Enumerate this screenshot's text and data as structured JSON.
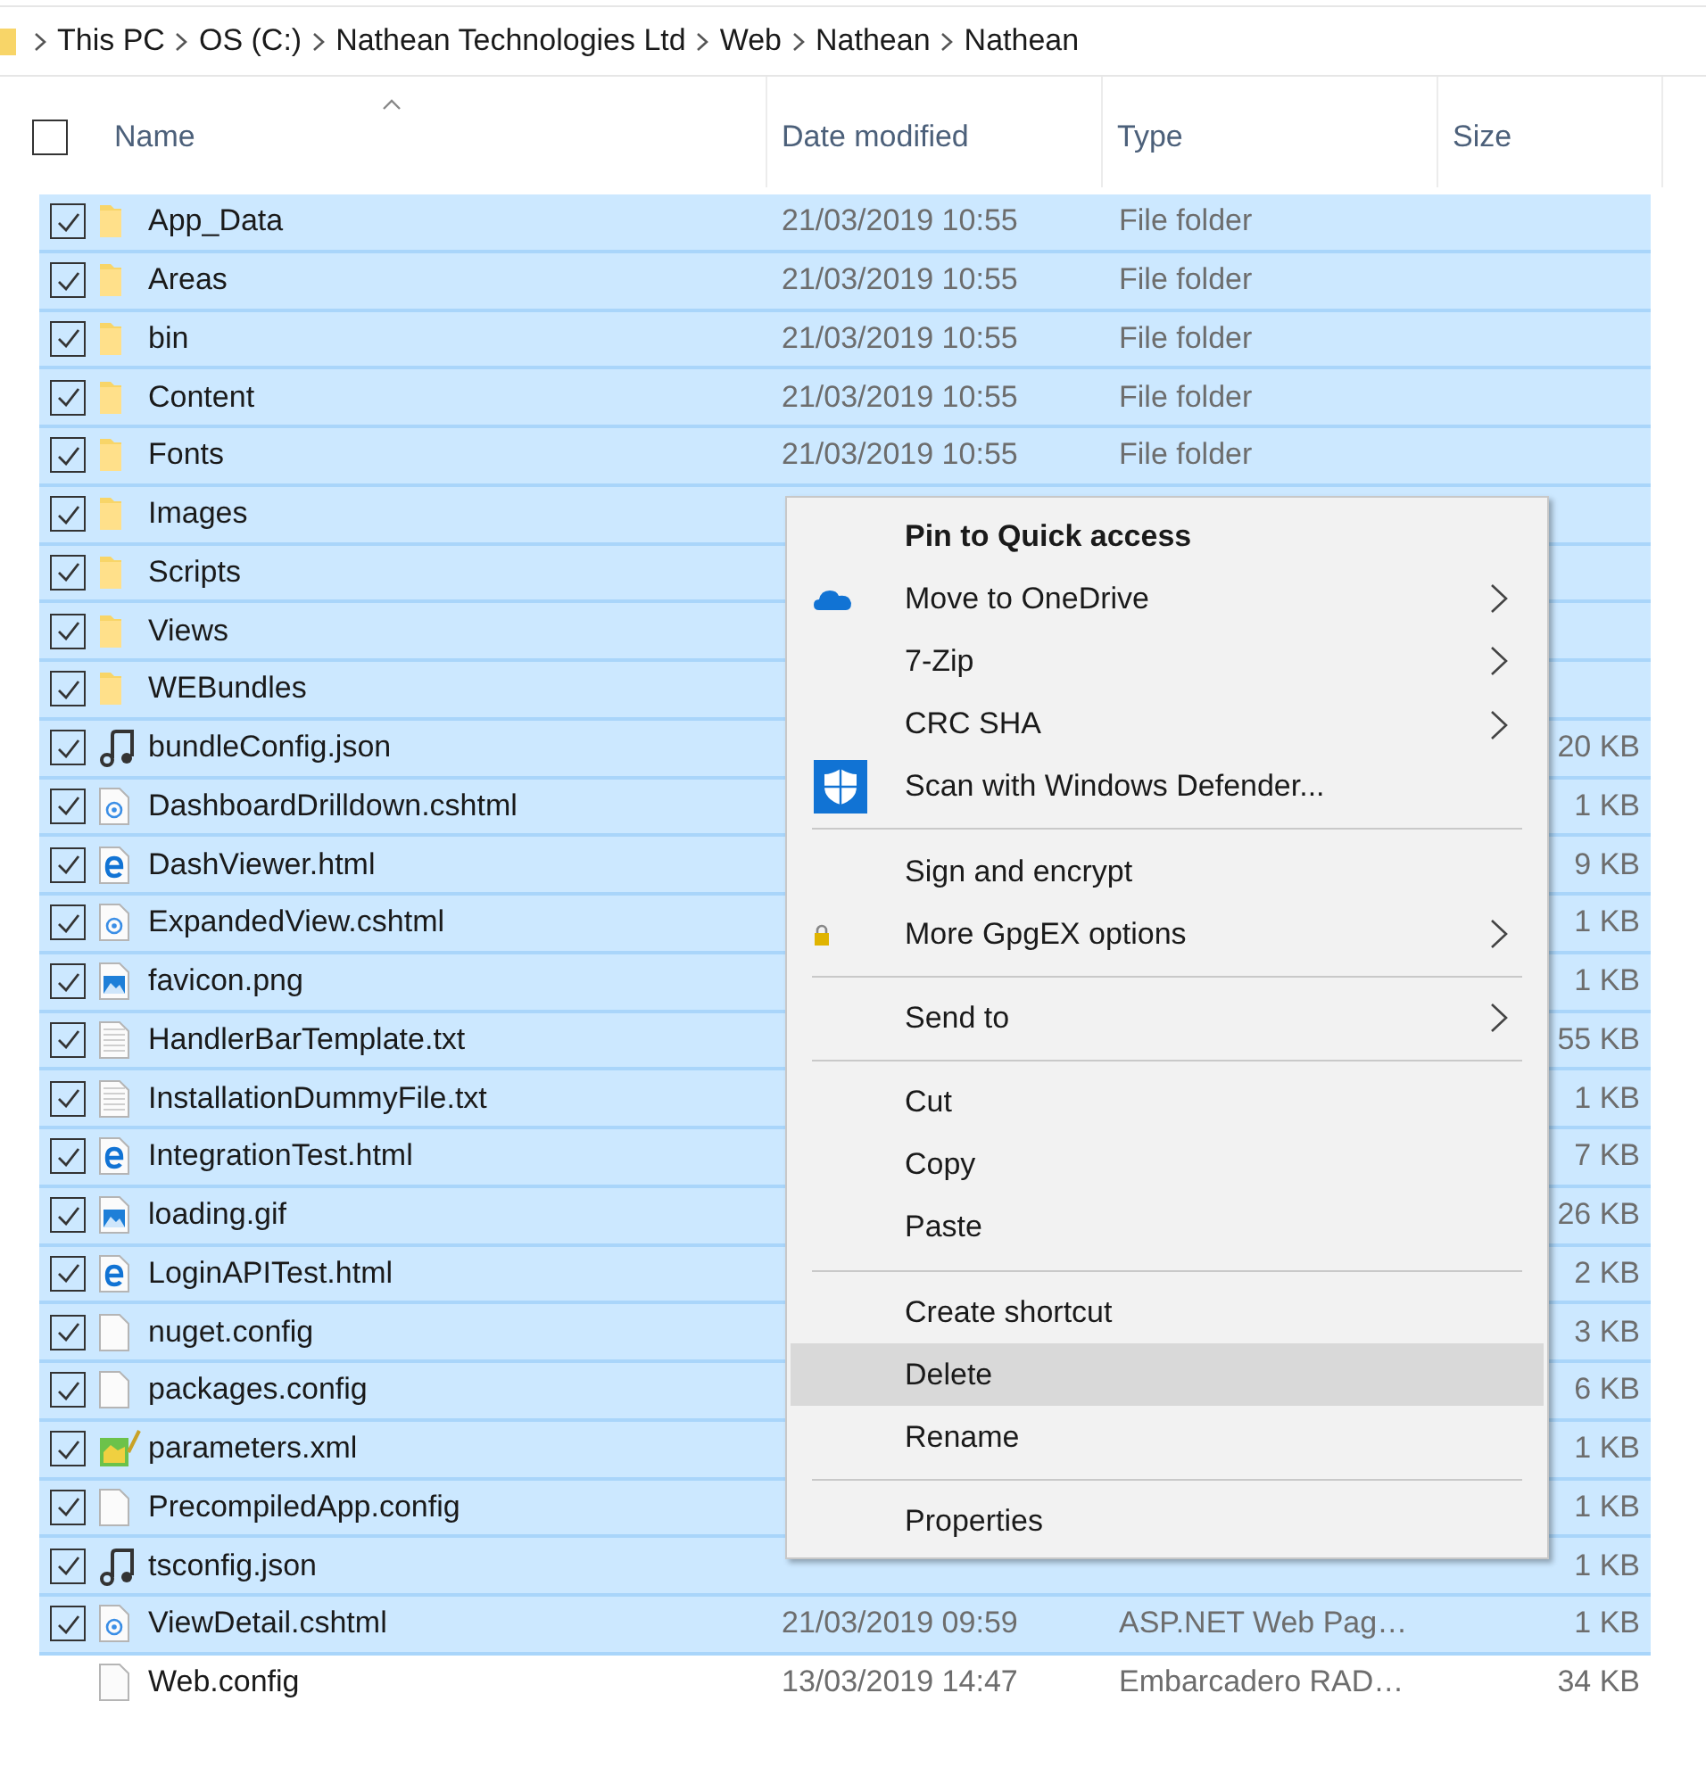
{
  "breadcrumb": [
    "This PC",
    "OS (C:)",
    "Nathean Technologies Ltd",
    "Web",
    "Nathean",
    "Nathean"
  ],
  "header": {
    "select_all": {
      "checked": false
    },
    "columns": [
      "Name",
      "Date modified",
      "Type",
      "Size"
    ]
  },
  "rows": [
    {
      "kind": "folder",
      "name": "App_Data",
      "date": "21/03/2019 10:55",
      "type": "File folder",
      "selected": true
    },
    {
      "kind": "folder",
      "name": "Areas",
      "date": "21/03/2019 10:55",
      "type": "File folder",
      "selected": true
    },
    {
      "kind": "folder",
      "name": "bin",
      "date": "21/03/2019 10:55",
      "type": "File folder",
      "selected": true
    },
    {
      "kind": "folder",
      "name": "Content",
      "date": "21/03/2019 10:55",
      "type": "File folder",
      "selected": true
    },
    {
      "kind": "folder",
      "name": "Fonts",
      "date": "21/03/2019 10:55",
      "type": "File folder",
      "selected": true
    },
    {
      "kind": "folder",
      "name": "Images",
      "selected": true
    },
    {
      "kind": "folder",
      "name": "Scripts",
      "selected": true
    },
    {
      "kind": "folder",
      "name": "Views",
      "selected": true
    },
    {
      "kind": "folder",
      "name": "WEBundles",
      "selected": true
    },
    {
      "kind": "json",
      "name": "bundleConfig.json",
      "size": "20 KB",
      "selected": true
    },
    {
      "kind": "cshtml",
      "name": "DashboardDrilldown.cshtml",
      "size": "1 KB",
      "selected": true
    },
    {
      "kind": "html",
      "name": "DashViewer.html",
      "size": "9 KB",
      "selected": true
    },
    {
      "kind": "cshtml",
      "name": "ExpandedView.cshtml",
      "size": "1 KB",
      "selected": true
    },
    {
      "kind": "image",
      "name": "favicon.png",
      "size": "1 KB",
      "selected": true
    },
    {
      "kind": "text",
      "name": "HandlerBarTemplate.txt",
      "size": "55 KB",
      "selected": true
    },
    {
      "kind": "text",
      "name": "InstallationDummyFile.txt",
      "size": "1 KB",
      "selected": true
    },
    {
      "kind": "html",
      "name": "IntegrationTest.html",
      "size": "7 KB",
      "selected": true
    },
    {
      "kind": "image",
      "name": "loading.gif",
      "size": "26 KB",
      "selected": true
    },
    {
      "kind": "html",
      "name": "LoginAPITest.html",
      "size": "2 KB",
      "selected": true
    },
    {
      "kind": "blank",
      "name": "nuget.config",
      "size": "3 KB",
      "selected": true
    },
    {
      "kind": "blank",
      "name": "packages.config",
      "size": "6 KB",
      "selected": true
    },
    {
      "kind": "xml",
      "name": "parameters.xml",
      "size": "1 KB",
      "selected": true
    },
    {
      "kind": "blank",
      "name": "PrecompiledApp.config",
      "size": "1 KB",
      "selected": true
    },
    {
      "kind": "json",
      "name": "tsconfig.json",
      "size": "1 KB",
      "selected": true
    },
    {
      "kind": "cshtml",
      "name": "ViewDetail.cshtml",
      "date": "21/03/2019 09:59",
      "type": "ASP.NET Web Pag…",
      "size": "1 KB",
      "selected": true
    },
    {
      "kind": "blank",
      "name": "Web.config",
      "date": "13/03/2019 14:47",
      "type": "Embarcadero RAD…",
      "size": "34 KB",
      "selected": false
    }
  ],
  "context_menu": [
    {
      "kind": "item",
      "label": "Pin to Quick access",
      "bold": true,
      "submenu": false,
      "highlighted": false
    },
    {
      "kind": "onedrive",
      "label": "Move to OneDrive",
      "bold": false,
      "submenu": true,
      "highlighted": false
    },
    {
      "kind": "item",
      "label": "7-Zip",
      "bold": false,
      "submenu": true,
      "highlighted": false
    },
    {
      "kind": "item",
      "label": "CRC SHA",
      "bold": false,
      "submenu": true,
      "highlighted": false
    },
    {
      "kind": "defender",
      "label": "Scan with Windows Defender...",
      "bold": false,
      "submenu": false,
      "highlighted": false
    },
    {
      "kind": "separator"
    },
    {
      "kind": "item",
      "label": "Sign and encrypt",
      "bold": false,
      "submenu": false,
      "highlighted": false
    },
    {
      "kind": "lock",
      "label": "More GpgEX options",
      "bold": false,
      "submenu": true,
      "highlighted": false
    },
    {
      "kind": "separator"
    },
    {
      "kind": "item",
      "label": "Send to",
      "bold": false,
      "submenu": true,
      "highlighted": false
    },
    {
      "kind": "separator"
    },
    {
      "kind": "item",
      "label": "Cut",
      "bold": false,
      "submenu": false,
      "highlighted": false
    },
    {
      "kind": "item",
      "label": "Copy",
      "bold": false,
      "submenu": false,
      "highlighted": false
    },
    {
      "kind": "item",
      "label": "Paste",
      "bold": false,
      "submenu": false,
      "highlighted": false
    },
    {
      "kind": "separator"
    },
    {
      "kind": "item",
      "label": "Create shortcut",
      "bold": false,
      "submenu": false,
      "highlighted": false
    },
    {
      "kind": "item",
      "label": "Delete",
      "bold": false,
      "submenu": false,
      "highlighted": true
    },
    {
      "kind": "item",
      "label": "Rename",
      "bold": false,
      "submenu": false,
      "highlighted": false
    },
    {
      "kind": "separator"
    },
    {
      "kind": "item",
      "label": "Properties",
      "bold": false,
      "submenu": false,
      "highlighted": false
    }
  ]
}
